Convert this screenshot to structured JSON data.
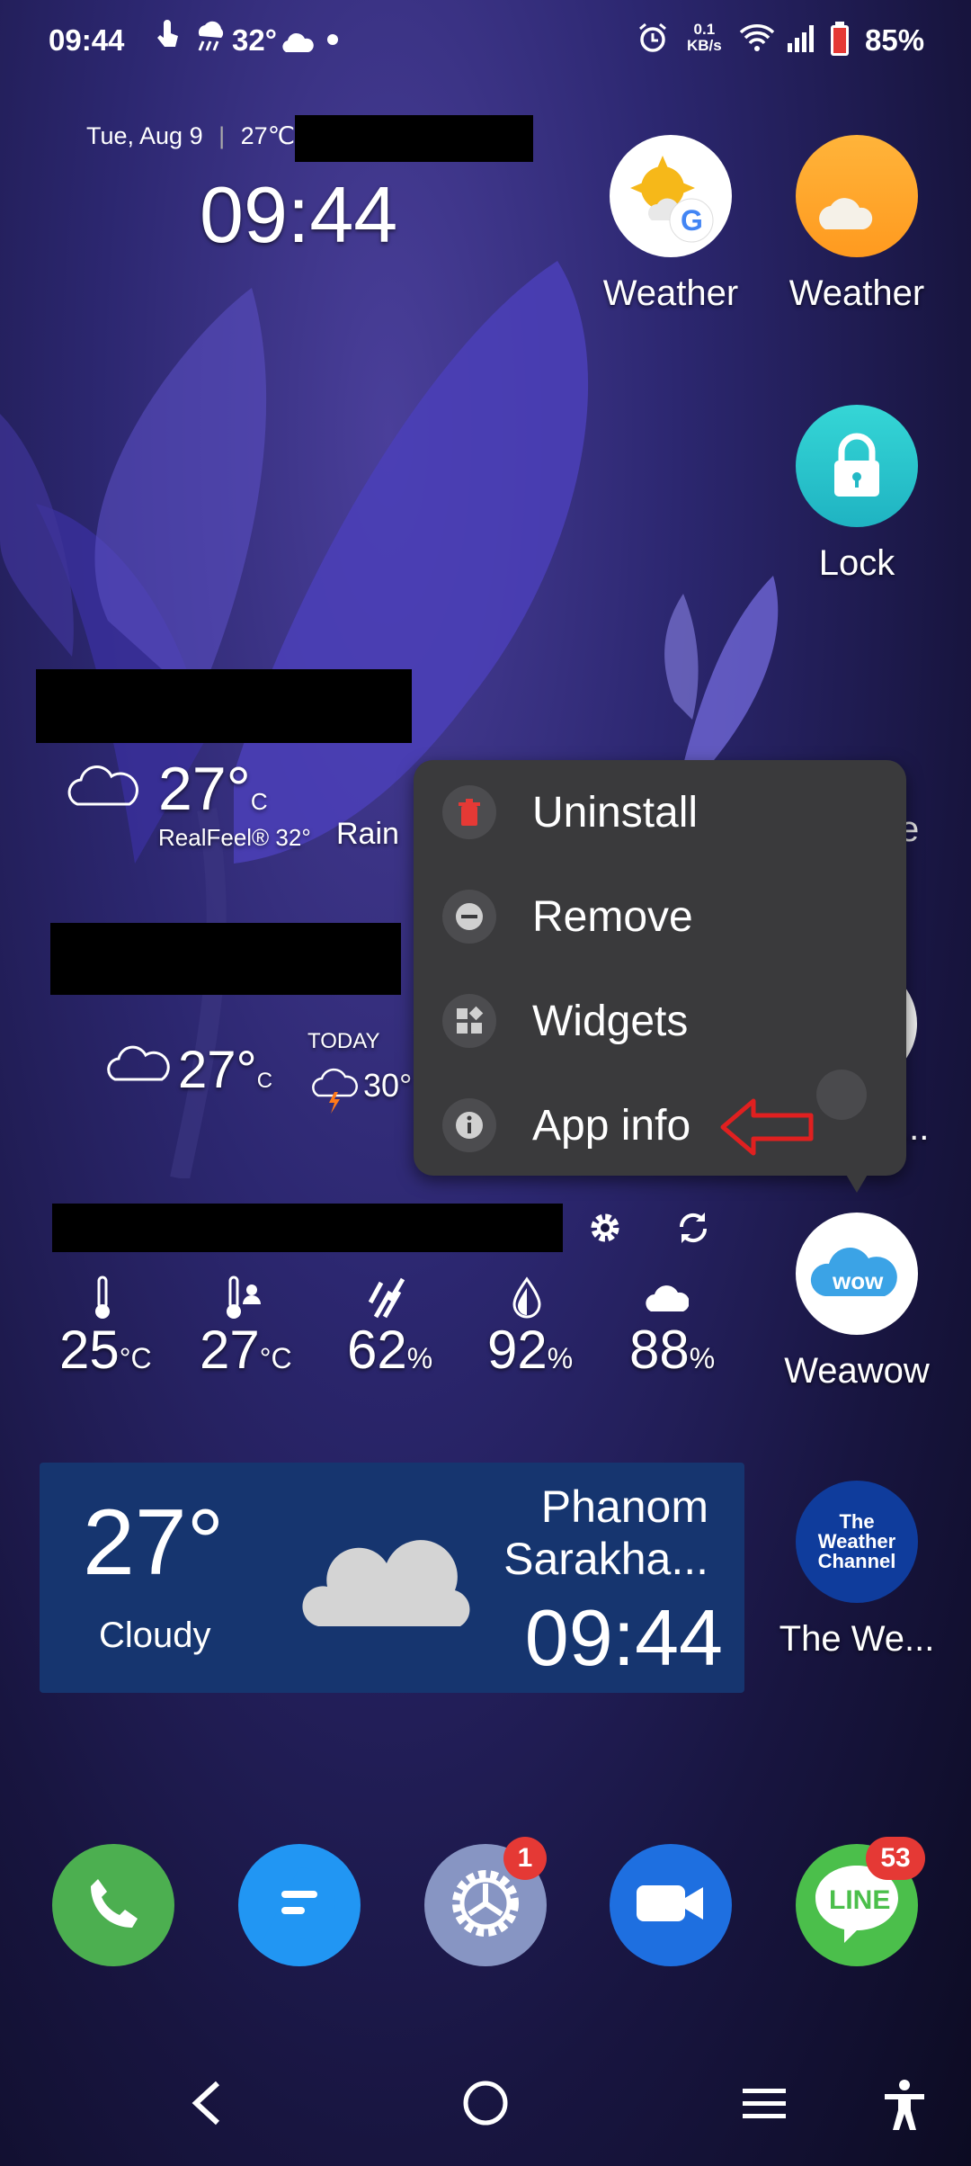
{
  "status_bar": {
    "time": "09:44",
    "temperature": "32°",
    "network_speed_value": "0.1",
    "network_speed_unit": "KB/s",
    "battery": "85%"
  },
  "clock_widget": {
    "date_temp": "Tue, Aug 9",
    "temp": "27℃",
    "time": "09:44"
  },
  "apps": {
    "weather_google": "Weather",
    "weather": "Weather",
    "lock": "Lock",
    "weawow": "Weawow",
    "weather_channel": "The We...",
    "weather_channel_logo": "The Weather Channel",
    "partial_label": "..."
  },
  "accuweather_widget": {
    "temp": "27°",
    "unit": "C",
    "realfeel": "RealFeel® 32°",
    "rain": "Rain"
  },
  "widget2": {
    "temp": "27°",
    "unit": "C",
    "today_label": "TODAY",
    "today_temp": "30°"
  },
  "stats_widget": {
    "items": [
      {
        "value": "25",
        "unit": "°C"
      },
      {
        "value": "27",
        "unit": "°C"
      },
      {
        "value": "62",
        "unit": "%"
      },
      {
        "value": "92",
        "unit": "%"
      },
      {
        "value": "88",
        "unit": "%"
      }
    ]
  },
  "weather_card": {
    "temp": "27°",
    "condition": "Cloudy",
    "location_line1": "Phanom",
    "location_line2": "Sarakha...",
    "time": "09:44"
  },
  "context_menu": {
    "items": [
      {
        "label": "Uninstall",
        "icon": "trash-icon"
      },
      {
        "label": "Remove",
        "icon": "minus-circle-icon"
      },
      {
        "label": "Widgets",
        "icon": "widgets-icon"
      },
      {
        "label": "App info",
        "icon": "info-icon"
      }
    ]
  },
  "dock": {
    "settings_badge": "1",
    "line_badge": "53",
    "line_text": "LINE"
  },
  "colors": {
    "menu_bg": "#3a3a3c",
    "arrow": "#e02020",
    "card_bg": "#16356f",
    "badge": "#e53935"
  }
}
